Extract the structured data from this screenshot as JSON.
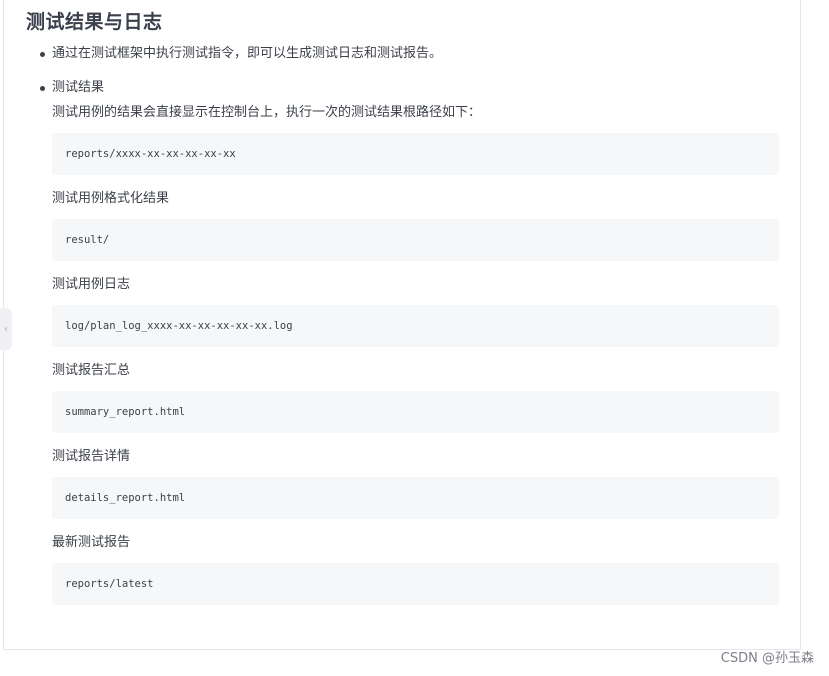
{
  "heading": "测试结果与日志",
  "bullets": [
    "通过在测试框架中执行测试指令，即可以生成测试日志和测试报告。",
    "测试结果"
  ],
  "intro": "测试用例的结果会直接显示在控制台上，执行一次的测试结果根路径如下：",
  "sections": [
    {
      "code": "reports/xxxx-xx-xx-xx-xx-xx"
    },
    {
      "label": "测试用例格式化结果",
      "code": "result/"
    },
    {
      "label": "测试用例日志",
      "code": "log/plan_log_xxxx-xx-xx-xx-xx-xx.log"
    },
    {
      "label": "测试报告汇总",
      "code": "summary_report.html"
    },
    {
      "label": "测试报告详情",
      "code": "details_report.html"
    },
    {
      "label": "最新测试报告",
      "code": "reports/latest"
    }
  ],
  "watermark": "CSDN @孙玉森",
  "collapse_icon": "chevron-left-icon"
}
